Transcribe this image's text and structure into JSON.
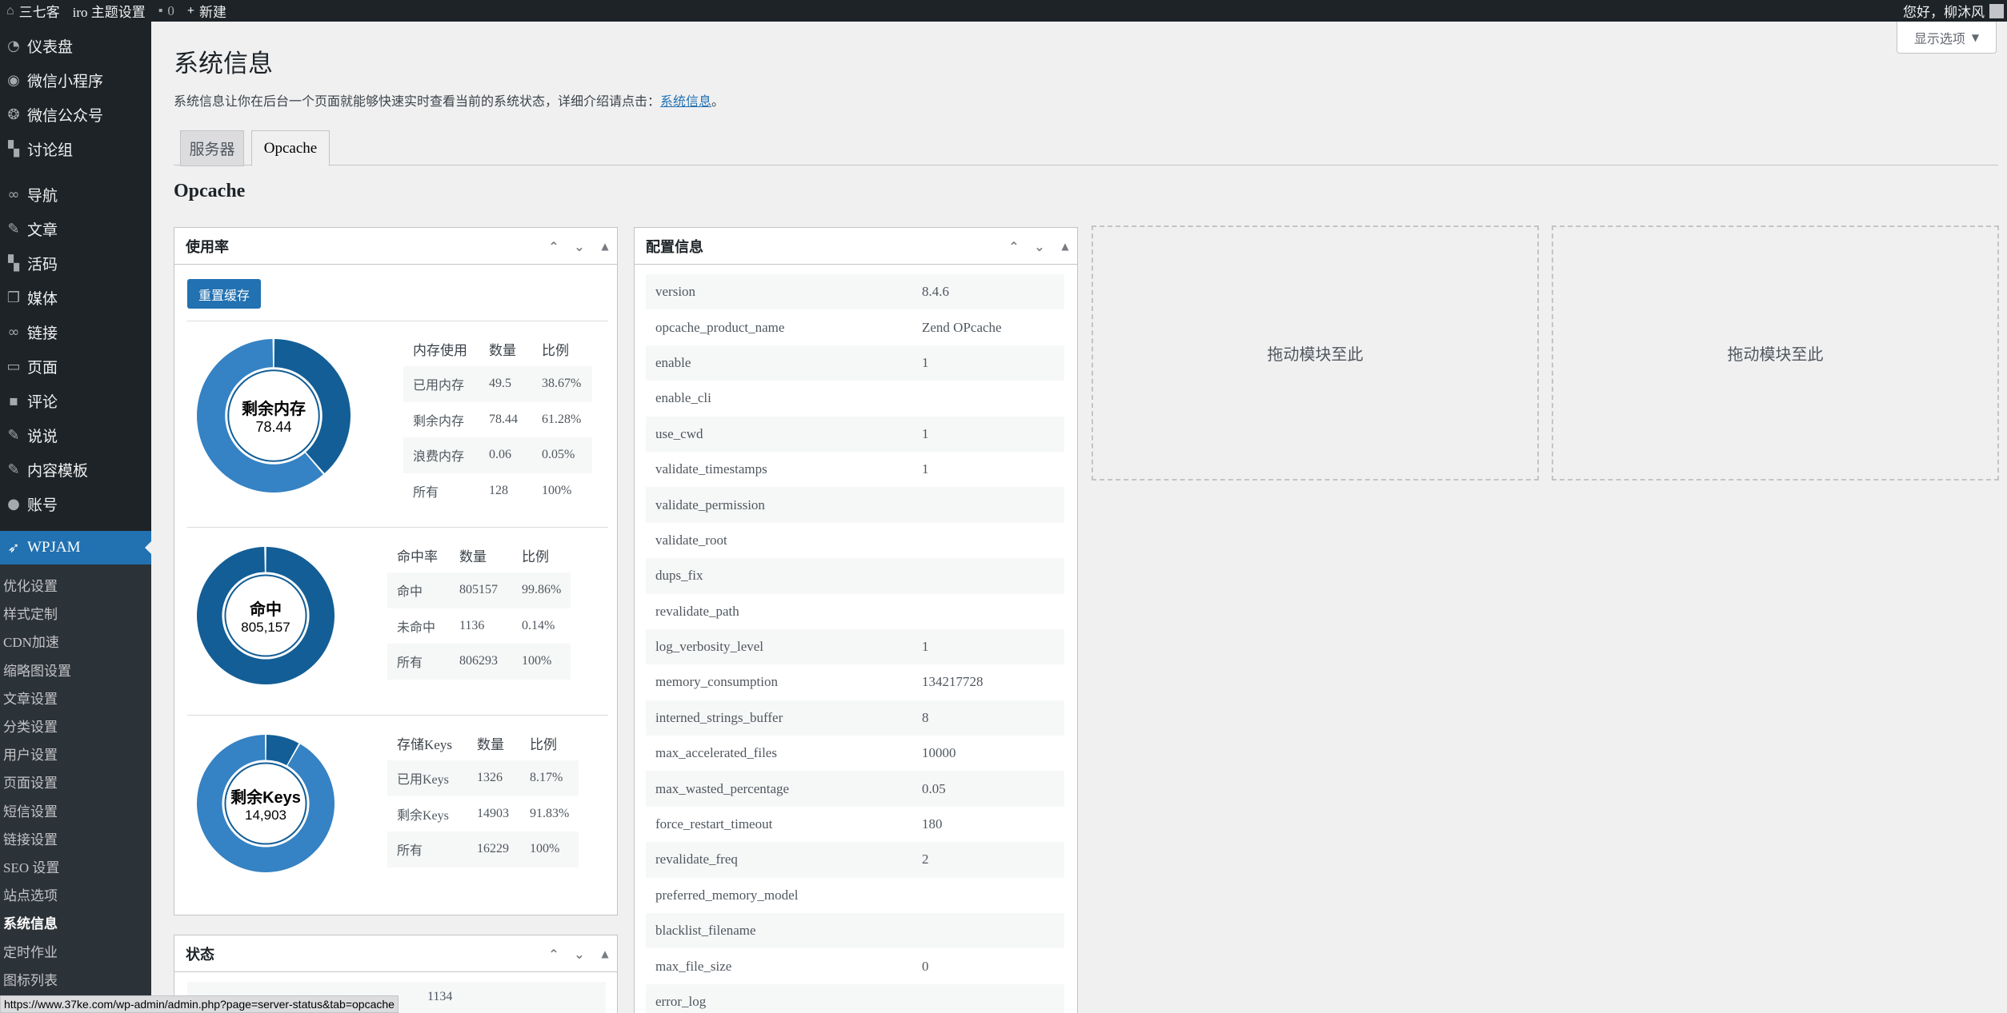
{
  "admin_bar": {
    "site_name": "三七客",
    "theme_settings": "iro 主题设置",
    "comments_count": "0",
    "new_label": "新建",
    "greeting": "您好，柳沐风"
  },
  "sidebar": {
    "items": [
      {
        "label": "仪表盘",
        "icon": "dashboard-icon"
      },
      {
        "label": "微信小程序",
        "icon": "wechat-miniprogram-icon"
      },
      {
        "label": "微信公众号",
        "icon": "wechat-icon"
      },
      {
        "label": "讨论组",
        "icon": "discussion-icon"
      },
      {
        "label": "导航",
        "icon": "link-icon"
      },
      {
        "label": "文章",
        "icon": "pin-icon"
      },
      {
        "label": "活码",
        "icon": "comments-icon"
      },
      {
        "label": "媒体",
        "icon": "media-icon"
      },
      {
        "label": "链接",
        "icon": "link-icon"
      },
      {
        "label": "页面",
        "icon": "page-icon"
      },
      {
        "label": "评论",
        "icon": "comment-icon"
      },
      {
        "label": "说说",
        "icon": "pin-icon"
      },
      {
        "label": "内容模板",
        "icon": "edit-icon"
      },
      {
        "label": "账号",
        "icon": "user-icon"
      }
    ],
    "current": {
      "label": "WPJAM",
      "icon": "rocket-icon"
    },
    "submenu": [
      "优化设置",
      "样式定制",
      "CDN加速",
      "缩略图设置",
      "文章设置",
      "分类设置",
      "用户设置",
      "页面设置",
      "短信设置",
      "链接设置",
      "SEO 设置",
      "站点选项",
      "系统信息",
      "定时作业",
      "图标列表"
    ],
    "submenu_current": "系统信息"
  },
  "screen_options": "显示选项",
  "page": {
    "title": "系统信息",
    "description": "系统信息让你在后台一个页面就能够快速实时查看当前的系统状态，详细介绍请点击：",
    "description_link": "系统信息",
    "description_end": "。",
    "tabs": [
      "服务器",
      "Opcache"
    ],
    "active_tab": "Opcache",
    "section_title": "Opcache"
  },
  "usage_box": {
    "title": "使用率",
    "reset_button": "重置缓存",
    "memory": {
      "center_title": "剩余内存",
      "center_value": "78.44",
      "headers": [
        "内存使用",
        "数量",
        "比例"
      ],
      "rows": [
        [
          "已用内存",
          "49.5",
          "38.67%"
        ],
        [
          "剩余内存",
          "78.44",
          "61.28%"
        ],
        [
          "浪费内存",
          "0.06",
          "0.05%"
        ],
        [
          "所有",
          "128",
          "100%"
        ]
      ],
      "fractions": [
        0.3867,
        0.6128,
        0.0005
      ]
    },
    "hits": {
      "center_title": "命中",
      "center_value": "805,157",
      "headers": [
        "命中率",
        "数量",
        "比例"
      ],
      "rows": [
        [
          "命中",
          "805157",
          "99.86%"
        ],
        [
          "未命中",
          "1136",
          "0.14%"
        ],
        [
          "所有",
          "806293",
          "100%"
        ]
      ],
      "fractions": [
        0.9986,
        0.0014
      ]
    },
    "keys": {
      "center_title": "剩余Keys",
      "center_value": "14,903",
      "headers": [
        "存储Keys",
        "数量",
        "比例"
      ],
      "rows": [
        [
          "已用Keys",
          "1326",
          "8.17%"
        ],
        [
          "剩余Keys",
          "14903",
          "91.83%"
        ],
        [
          "所有",
          "16229",
          "100%"
        ]
      ],
      "fractions": [
        0.0817,
        0.9183
      ]
    }
  },
  "status_box": {
    "title": "状态",
    "partial_value": "1134"
  },
  "config_box": {
    "title": "配置信息",
    "rows": [
      [
        "version",
        "8.4.6"
      ],
      [
        "opcache_product_name",
        "Zend OPcache"
      ],
      [
        "enable",
        "1"
      ],
      [
        "enable_cli",
        ""
      ],
      [
        "use_cwd",
        "1"
      ],
      [
        "validate_timestamps",
        "1"
      ],
      [
        "validate_permission",
        ""
      ],
      [
        "validate_root",
        ""
      ],
      [
        "dups_fix",
        ""
      ],
      [
        "revalidate_path",
        ""
      ],
      [
        "log_verbosity_level",
        "1"
      ],
      [
        "memory_consumption",
        "134217728"
      ],
      [
        "interned_strings_buffer",
        "8"
      ],
      [
        "max_accelerated_files",
        "10000"
      ],
      [
        "max_wasted_percentage",
        "0.05"
      ],
      [
        "force_restart_timeout",
        "180"
      ],
      [
        "revalidate_freq",
        "2"
      ],
      [
        "preferred_memory_model",
        ""
      ],
      [
        "blacklist_filename",
        ""
      ],
      [
        "max_file_size",
        "0"
      ],
      [
        "error_log",
        ""
      ]
    ]
  },
  "dropzones": [
    "拖动模块至此",
    "拖动模块至此"
  ],
  "status_url": "https://www.37ke.com/wp-admin/admin.php?page=server-status&tab=opcache",
  "colors": {
    "dark": "#1d2327",
    "accent": "#2271b1",
    "donut_dark": "#135e96",
    "donut_light": "#3582c4"
  }
}
